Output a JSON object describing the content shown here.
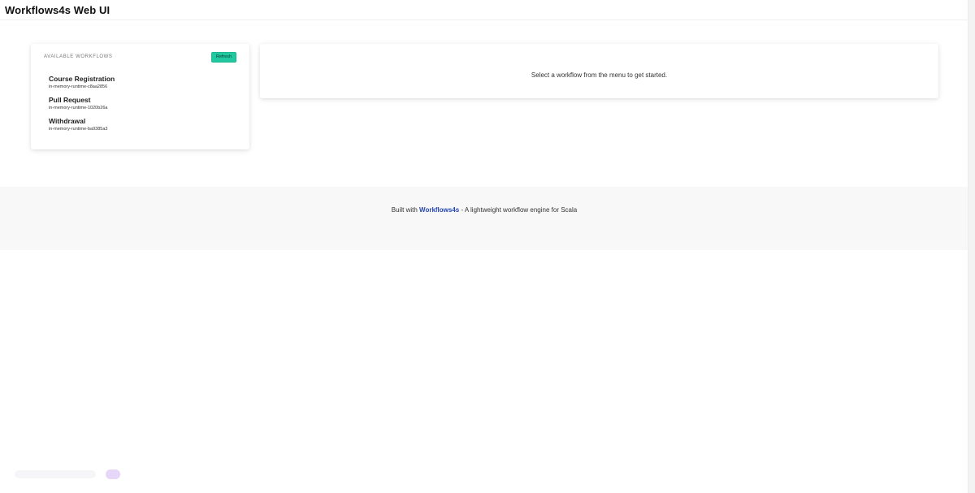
{
  "header": {
    "title": "Workflows4s Web UI"
  },
  "sidebar": {
    "heading": "AVAILABLE WORKFLOWS",
    "refresh_label": "Refresh",
    "workflows": [
      {
        "name": "Course Registration",
        "id": "in-memory-runtime-c8aa2856"
      },
      {
        "name": "Pull Request",
        "id": "in-memory-runtime-1020b26a"
      },
      {
        "name": "Withdrawal",
        "id": "in-memory-runtime-ba9385a3"
      }
    ]
  },
  "main": {
    "message": "Select a workflow from the menu to get started."
  },
  "footer": {
    "prefix": "Built with",
    "link_text": "Workflows4s",
    "suffix": "- A lightweight workflow engine for Scala"
  },
  "colors": {
    "accent": "#22c9a0",
    "link": "#2346b0"
  }
}
